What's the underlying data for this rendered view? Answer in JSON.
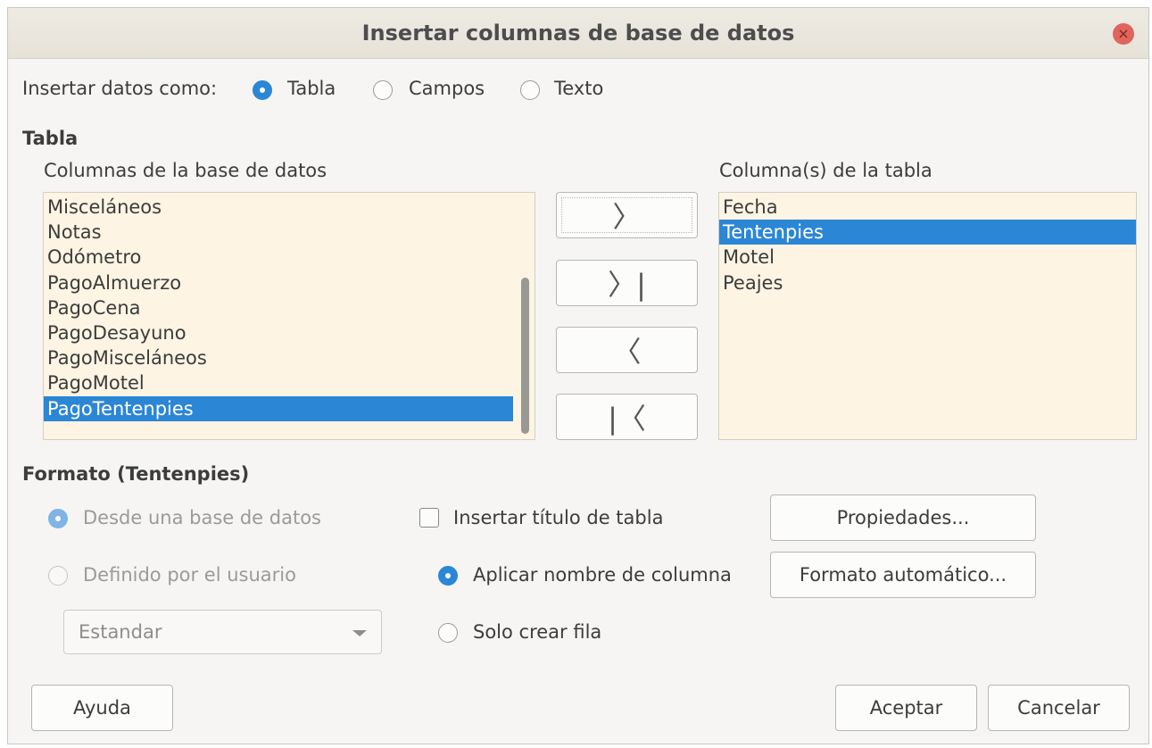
{
  "window": {
    "title": "Insertar columnas de base de datos",
    "close_glyph": "×"
  },
  "insert_as": {
    "label": "Insertar datos como:",
    "options": [
      "Tabla",
      "Campos",
      "Texto"
    ],
    "selected": "Tabla"
  },
  "table_section": {
    "heading": "Tabla",
    "db_columns_label": "Columnas de la base de datos",
    "db_columns": [
      "Misceláneos",
      "Notas",
      "Odómetro",
      "PagoAlmuerzo",
      "PagoCena",
      "PagoDesayuno",
      "PagoMisceláneos",
      "PagoMotel",
      "PagoTentenpies"
    ],
    "db_selected": "PagoTentenpies",
    "table_columns_label": "Columna(s) de la tabla",
    "table_columns": [
      "Fecha",
      "Tentenpies",
      "Motel",
      "Peajes"
    ],
    "table_selected": "Tentenpies",
    "move_buttons": {
      "add_one": "〉",
      "add_all": "〉|",
      "remove_one": "〈",
      "remove_all": "|〈"
    }
  },
  "format_section": {
    "heading": "Formato (Tentenpies)",
    "from_db_label": "Desde una base de datos",
    "user_defined_label": "Definido por el usuario",
    "format_combo_value": "Estandar",
    "insert_title_label": "Insertar título de tabla",
    "apply_colname_label": "Aplicar nombre de columna",
    "only_row_label": "Solo crear fila",
    "properties_button": "Propiedades...",
    "autoformat_button": "Formato automático..."
  },
  "footer": {
    "help": "Ayuda",
    "ok": "Aceptar",
    "cancel": "Cancelar"
  },
  "colors": {
    "accent": "#2c86d6",
    "list_bg": "#fdf4e3",
    "close": "#e0655c"
  }
}
